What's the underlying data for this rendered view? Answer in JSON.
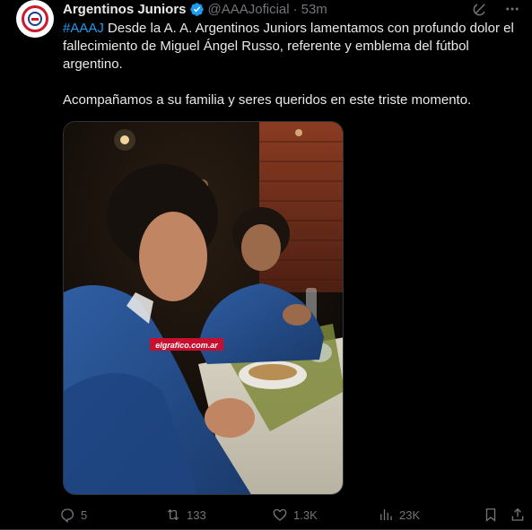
{
  "tweet": {
    "author_name": "Argentinos Juniors",
    "handle": "@AAAJoficial",
    "separator": "·",
    "time": "53m",
    "hashtag": "#AAAJ",
    "body_line1_rest": " Desde la A. A. Argentinos Juniors lamentamos con profundo dolor el fallecimiento de Miguel Ángel Russo, referente y emblema del fútbol argentino.",
    "body_paragraph2": "Acompañamos a su familia y seres queridos en este triste momento.",
    "media_watermark": "elgrafico.com.ar"
  },
  "icons": {
    "avatar": "club-crest-icon",
    "verified": "verified-badge-icon",
    "grok": "grok-icon",
    "more": "more-dots-icon",
    "reply": "reply-icon",
    "retweet": "retweet-icon",
    "like": "heart-icon",
    "views": "views-chart-icon",
    "bookmark": "bookmark-icon",
    "share": "share-icon"
  },
  "actions": {
    "replies": "5",
    "retweets": "133",
    "likes": "1.3K",
    "views": "23K"
  },
  "colors": {
    "background": "#000000",
    "text": "#e7e9ea",
    "muted": "#71767b",
    "accent": "#1d9bf0",
    "crest_red": "#d0182b"
  }
}
